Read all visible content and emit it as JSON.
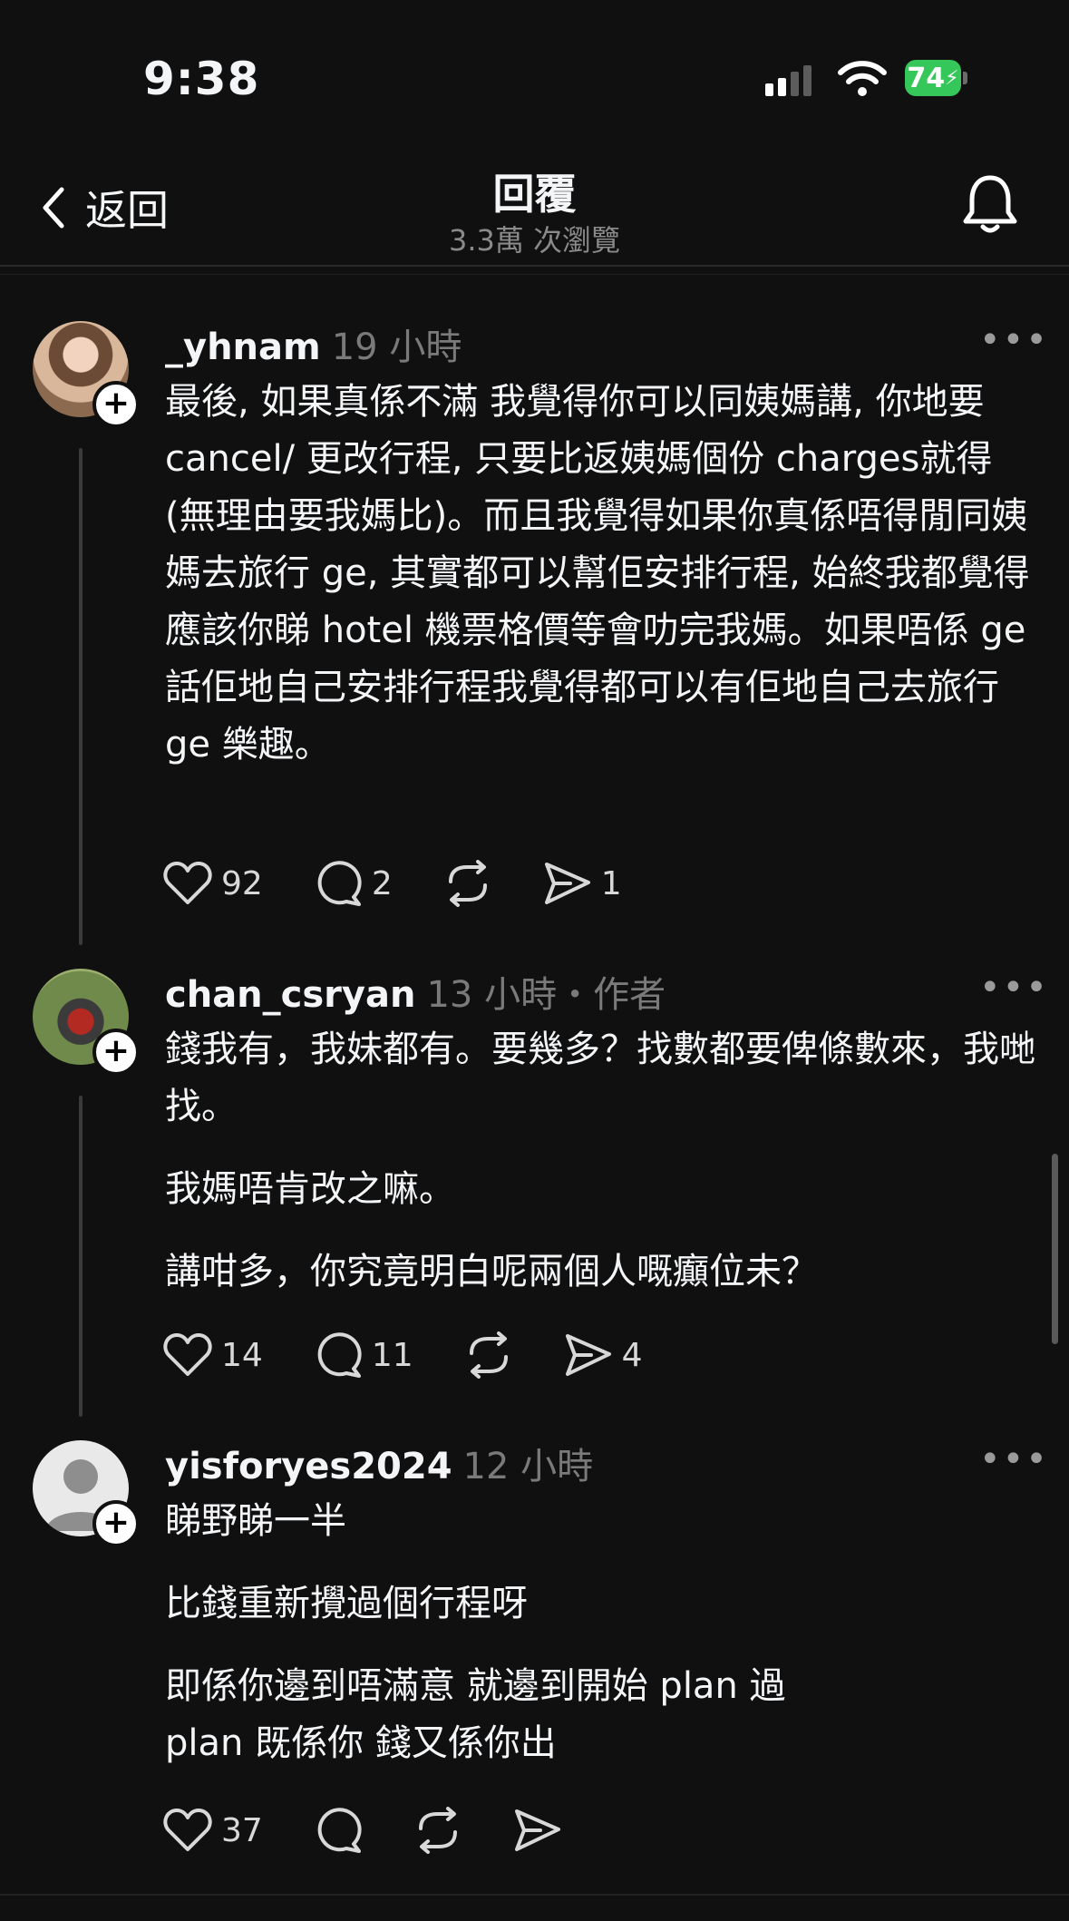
{
  "status_bar": {
    "time": "9:38",
    "battery": "74"
  },
  "header": {
    "back_label": "返回",
    "title": "回覆",
    "subtitle": "3.3萬 次瀏覽"
  },
  "posts": [
    {
      "username": "_yhnam",
      "meta": "19 小時",
      "paragraphs": [
        "最後, 如果真係不滿 我覺得你可以同姨媽講, 你地要 cancel/ 更改行程, 只要比返姨媽個份 charges就得 (無理由要我媽比)。而且我覺得如果你真係唔得閒同姨媽去旅行 ge, 其實都可以幫佢安排行程, 始終我都覺得應該你睇 hotel 機票格價等會叻完我媽。如果唔係 ge話佢地自己安排行程我覺得都可以有佢地自己去旅行 ge 樂趣。"
      ],
      "likes": "92",
      "replies": "2",
      "shares": "1"
    },
    {
      "username": "chan_csryan",
      "meta": "13 小時・作者",
      "paragraphs": [
        "錢我有，我妹都有。要幾多？找數都要俾條數來，我哋找。",
        "我媽唔肯改之嘛。",
        "講咁多，你究竟明白呢兩個人嘅癲位未？"
      ],
      "likes": "14",
      "replies": "11",
      "shares": "4"
    },
    {
      "username": "yisforyes2024",
      "meta": "12 小時",
      "paragraphs": [
        "睇野睇一半",
        "比錢重新攪過個行程呀",
        "即係你邊到唔滿意 就邊到開始 plan 過 plan 既係你 錢又係你出"
      ],
      "likes": "37",
      "replies": "",
      "shares": ""
    }
  ],
  "icons": {
    "back": "chevron-left-icon",
    "bell": "bell-icon",
    "like": "heart-icon",
    "reply": "comment-icon",
    "repost": "repost-icon",
    "share": "send-icon",
    "more": "more-icon"
  },
  "colors": {
    "background": "#101010",
    "text": "#f3f5f7",
    "muted": "#7a7a7a",
    "battery": "#35c759"
  }
}
